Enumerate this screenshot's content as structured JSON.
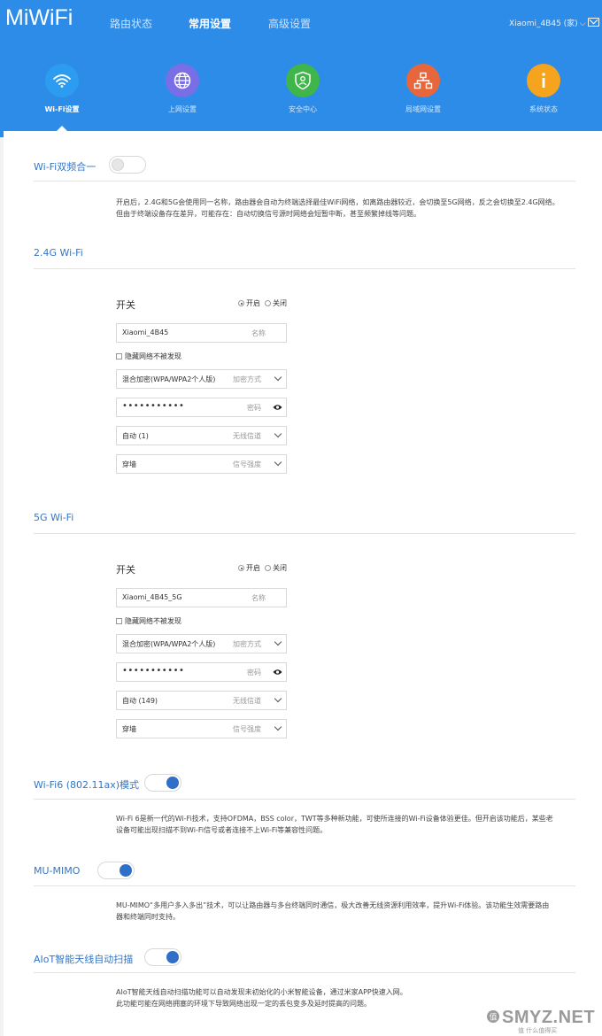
{
  "header": {
    "logo": "MiWiFi",
    "nav": [
      "路由状态",
      "常用设置",
      "高级设置"
    ],
    "active_nav": "常用设置",
    "account": "Xiaomi_4B45 (家)",
    "mail_icon": "mail-icon"
  },
  "functions": [
    {
      "label": "Wi-Fi设置",
      "icon": "wifi-icon",
      "color": "#2c9cf0",
      "active": true
    },
    {
      "label": "上网设置",
      "icon": "globe-icon",
      "color": "#7a6ee6"
    },
    {
      "label": "安全中心",
      "icon": "shield-icon",
      "color": "#3fb54a"
    },
    {
      "label": "局域网设置",
      "icon": "network-icon",
      "color": "#e8663c"
    },
    {
      "label": "系统状态",
      "icon": "info-icon",
      "color": "#f6a31e"
    }
  ],
  "dual_band": {
    "title": "Wi-Fi双频合一",
    "enabled": false,
    "desc1": "开启后，2.4G和5G会使用同一名称，路由器会自动为终端选择最佳WiFi网络，如离路由器较近，会切换至5G网络，反之会切换至2.4G网络。",
    "desc2": "但由于终端设备存在差异，可能存在：自动切换信号源时网络会短暂中断，甚至频繁掉线等问题。"
  },
  "wifi24": {
    "title": "2.4G Wi-Fi",
    "switch_label": "开关",
    "on_label": "开启",
    "off_label": "关闭",
    "ssid": "Xiaomi_4B45",
    "ssid_hint": "名称",
    "hide_label": "隐藏网络不被发现",
    "encryption": "混合加密(WPA/WPA2个人版)",
    "encryption_hint": "加密方式",
    "password": "•••••••••••",
    "password_hint": "密码",
    "channel": "自动 (1)",
    "channel_hint": "无线信道",
    "strength": "穿墙",
    "strength_hint": "信号强度"
  },
  "wifi5": {
    "title": "5G Wi-Fi",
    "switch_label": "开关",
    "on_label": "开启",
    "off_label": "关闭",
    "ssid": "Xiaomi_4B45_5G",
    "ssid_hint": "名称",
    "hide_label": "隐藏网络不被发现",
    "encryption": "混合加密(WPA/WPA2个人版)",
    "encryption_hint": "加密方式",
    "password": "•••••••••••",
    "password_hint": "密码",
    "channel": "自动 (149)",
    "channel_hint": "无线信道",
    "strength": "穿墙",
    "strength_hint": "信号强度"
  },
  "wifi6": {
    "title": "Wi-Fi6 (802.11ax)模式",
    "enabled": true,
    "desc1": "Wi-Fi 6是新一代的Wi-Fi技术，支持OFDMA，BSS color，TWT等多种新功能，可使所连接的Wi-Fi设备体验更佳。但开启该功能后，某些老",
    "desc2": "设备可能出现扫描不到Wi-Fi信号或者连接不上Wi-Fi等兼容性问题。"
  },
  "mumimo": {
    "title": "MU-MIMO",
    "enabled": true,
    "desc1": "MU-MIMO“多用户多入多出”技术，可以让路由器与多台终端同时通信，极大改善无线资源利用效率，提升Wi-Fi体验。该功能生效需要路由",
    "desc2": "器和终端同时支持。"
  },
  "aiot": {
    "title": "AIoT智能天线自动扫描",
    "enabled": true,
    "desc1": "AIoT智能天线自动扫描功能可以自动发现未初始化的小米智能设备，通过米家APP快速入网。",
    "desc2": "此功能可能在网络拥塞的环境下导致网络出现一定的丢包变多及延时提高的问题。"
  },
  "watermark": {
    "text": "SMYZ.NET",
    "sub": "值 什么值得买"
  }
}
